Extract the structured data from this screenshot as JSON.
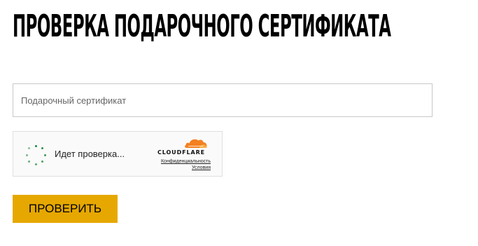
{
  "page": {
    "title": "ПРОВЕРКА ПОДАРОЧНОГО СЕРТИФИКАТА"
  },
  "form": {
    "certificate_placeholder": "Подарочный сертификат",
    "certificate_value": "",
    "submit_label": "ПРОВЕРИТЬ",
    "submit_color": "#e6a800"
  },
  "captcha": {
    "status_text": "Идет проверка...",
    "brand": "CLOUDFLARE",
    "privacy_link": "Конфиденциальность",
    "terms_link": "Условия",
    "spinner_color": "#1e8a3a",
    "brand_color": "#f38020",
    "spinner_icon": "loading-spinner-icon",
    "logo_icon": "cloudflare-cloud-icon"
  }
}
